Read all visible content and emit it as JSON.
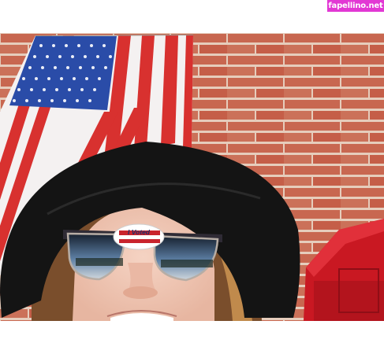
{
  "watermark": {
    "text": "fapellino.net"
  },
  "sticker": {
    "text": "I Voted"
  },
  "colors": {
    "brick": "#c9624a",
    "mortar": "#e8d2c3",
    "flag_red": "#d8312f",
    "flag_blue": "#2a4ca8",
    "hat": "#141414",
    "mailbox": "#d21d26"
  }
}
